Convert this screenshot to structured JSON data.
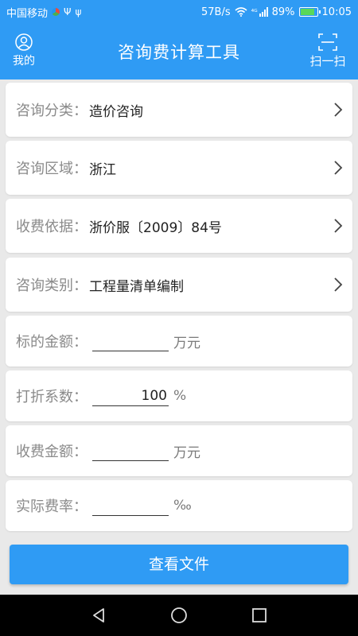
{
  "status_bar": {
    "carrier": "中国移动",
    "usb1": "Ψ",
    "usb2": "ψ",
    "speed": "57B/s",
    "signal_label": "⁴ᴳ",
    "battery": "89%",
    "battery_level": 0.89,
    "time": "10:05"
  },
  "app_bar": {
    "title": "咨询费计算工具",
    "left_label": "我的",
    "right_label": "扫一扫"
  },
  "form": {
    "category": {
      "label": "咨询分类：",
      "value": "造价咨询"
    },
    "region": {
      "label": "咨询区域：",
      "value": "浙江"
    },
    "basis": {
      "label": "收费依据：",
      "value": "浙价服〔2009〕84号"
    },
    "type": {
      "label": "咨询类别：",
      "value": "工程量清单编制"
    },
    "bid_amount": {
      "label": "标的金额：",
      "value": "",
      "unit": "万元"
    },
    "discount": {
      "label": "打折系数：",
      "value": "100",
      "unit": "%"
    },
    "fee_amount": {
      "label": "收费金额：",
      "value": "",
      "unit": "万元"
    },
    "actual_rate": {
      "label": "实际费率：",
      "value": "",
      "unit": "‰"
    }
  },
  "actions": {
    "view_file": "查看文件"
  },
  "colors": {
    "primary": "#2f9bf4",
    "background": "#e9e9e9"
  }
}
